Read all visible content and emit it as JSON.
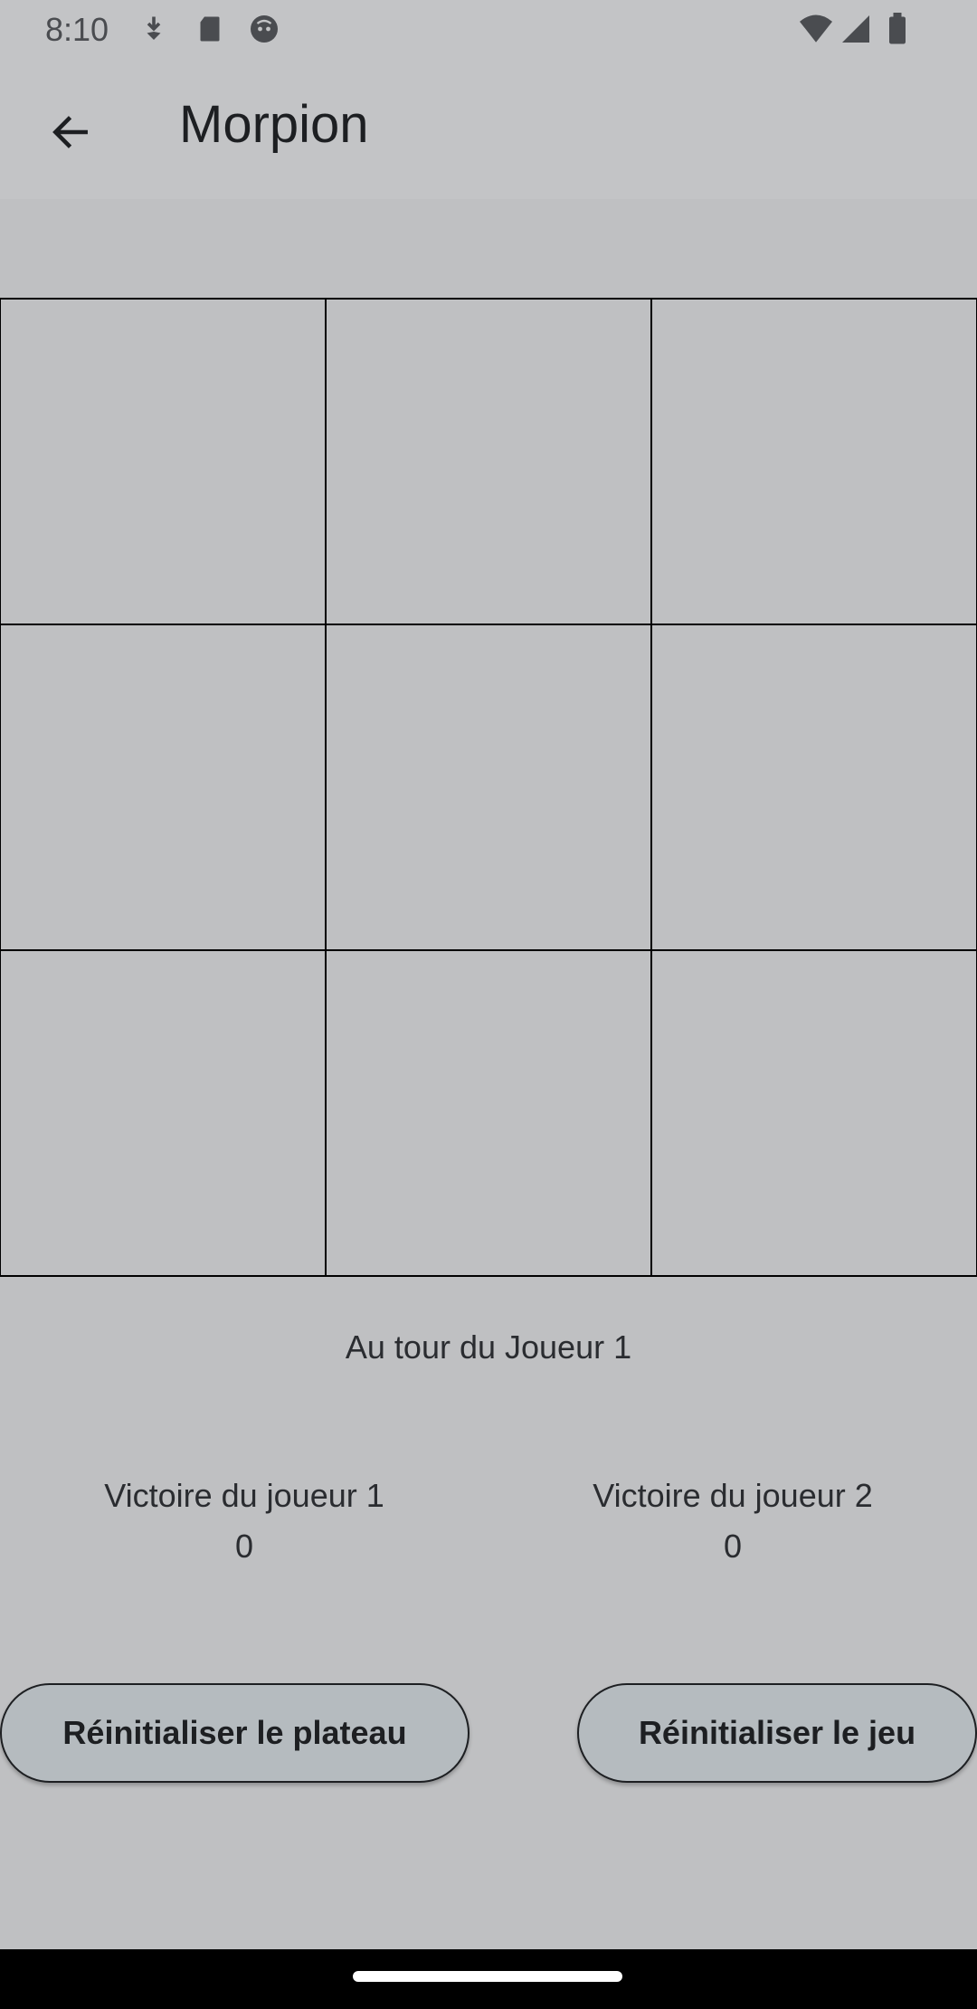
{
  "status_bar": {
    "time": "8:10",
    "left_icons": [
      "download-icon",
      "sd-card-icon",
      "android-icon"
    ],
    "right_icons": [
      "wifi-icon",
      "signal-icon",
      "battery-icon"
    ]
  },
  "app_bar": {
    "back_icon": "arrow-back-icon",
    "title": "Morpion"
  },
  "board": {
    "cells": [
      "",
      "",
      "",
      "",
      "",
      "",
      "",
      "",
      ""
    ],
    "line_color": "#000000"
  },
  "turn_text": "Au tour du Joueur 1",
  "scores": {
    "player1": {
      "label": "Victoire du joueur 1",
      "value": "0"
    },
    "player2": {
      "label": "Victoire du joueur 2",
      "value": "0"
    }
  },
  "buttons": {
    "reset_board": "Réinitialiser le plateau",
    "reset_game": "Réinitialiser le jeu"
  },
  "colors": {
    "background": "#bfc0c2",
    "button_fill": "#b5bbbf",
    "text": "#1d1f22"
  }
}
